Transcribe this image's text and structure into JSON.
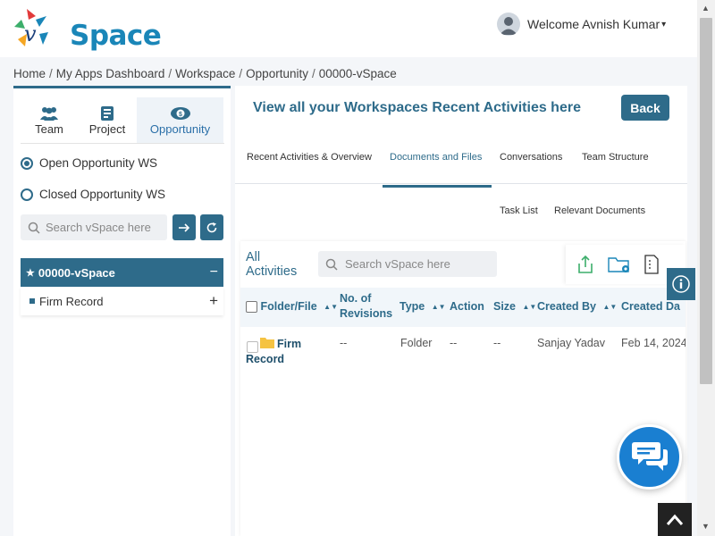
{
  "header": {
    "logo_text": "Space",
    "welcome": "Welcome Avnish Kumar",
    "caret": "▾"
  },
  "breadcrumb": [
    "Home",
    "My Apps Dashboard",
    "Workspace",
    "Opportunity",
    "00000-vSpace"
  ],
  "breadcrumb_sep": "/",
  "left": {
    "tabs": [
      {
        "label": "Team",
        "icon": "team-icon"
      },
      {
        "label": "Project",
        "icon": "project-icon"
      },
      {
        "label": "Opportunity",
        "icon": "opportunity-icon"
      }
    ],
    "radios": [
      {
        "label": "Open Opportunity WS",
        "checked": true
      },
      {
        "label": "Closed Opportunity WS",
        "checked": false
      }
    ],
    "search_placeholder": "Search vSpace here",
    "tree_head": "00000-vSpace",
    "tree_head_toggle": "−",
    "tree_item": "Firm Record",
    "tree_item_toggle": "+"
  },
  "right": {
    "title": "View all your Workspaces Recent Activities here",
    "back_label": "Back",
    "tabs": [
      "Recent Activities & Overview",
      "Documents and Files",
      "Conversations",
      "Team Structure"
    ],
    "active_tab": "Documents and Files",
    "subtabs": [
      "Task List",
      "Relevant Documents"
    ],
    "all_activities": [
      "All",
      "Activities"
    ],
    "search_placeholder": "Search vSpace here",
    "columns": [
      "Folder/File",
      "No. of",
      "Revisions",
      "Type",
      "Action",
      "Size",
      "Created By",
      "Created Da"
    ],
    "sort_glyph": "▲▼",
    "row": {
      "name_line1": "Firm",
      "name_line2": "Record",
      "revisions": "--",
      "type": "Folder",
      "action": "--",
      "size": "--",
      "created_by": "Sanjay Yadav",
      "created_date": "Feb 14, 2024"
    }
  },
  "colors": {
    "primary": "#2e6b8a",
    "brand": "#1a86b8",
    "chat": "#1a7fd1",
    "folder": "#f5c342",
    "export": "#3cae6b"
  }
}
